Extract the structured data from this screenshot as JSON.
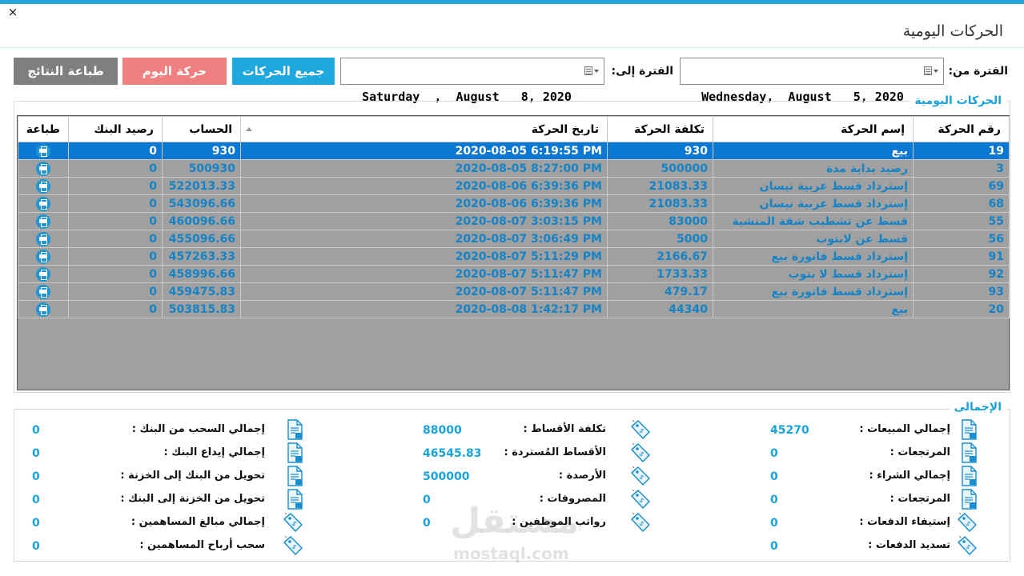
{
  "window": {
    "title": "الحركات اليومية",
    "close_glyph": "×"
  },
  "filters": {
    "from_label": "الفترة من:",
    "from_date": "Wednesday,  August   5, 2020",
    "to_label": "الفترة إلى:",
    "to_date": "Saturday  ,  August   8, 2020"
  },
  "buttons": {
    "all_movements": "جميع الحركات",
    "today_movements": "حركة اليوم",
    "print_results": "طباعة النتائج"
  },
  "colors": {
    "accent": "#1aa3d9",
    "selected_row": "#0a78d2",
    "today_button": "#f08080",
    "print_button": "#7f7f7f",
    "all_button": "#1ea8de"
  },
  "daily_group": {
    "title": "الحركات اليومية",
    "columns": [
      "رقم الحركة",
      "إسم الحركة",
      "تكلفة الحركة",
      "تاريخ الحركة",
      "الحساب",
      "رصيد البنك",
      "طباعة"
    ],
    "rows": [
      {
        "id": "19",
        "name": "بيع",
        "cost": "930",
        "date": "2020-08-05 6:19:55 PM",
        "account": "930",
        "bank": "0"
      },
      {
        "id": "3",
        "name": "رصيد بداية مدة",
        "cost": "500000",
        "date": "2020-08-05 8:27:00 PM",
        "account": "500930",
        "bank": "0"
      },
      {
        "id": "69",
        "name": "إسترداد قسط عربية نيسان",
        "cost": "21083.33",
        "date": "2020-08-06 6:39:36 PM",
        "account": "522013.33",
        "bank": "0"
      },
      {
        "id": "68",
        "name": "إسترداد قسط عربية نيسان",
        "cost": "21083.33",
        "date": "2020-08-06 6:39:36 PM",
        "account": "543096.66",
        "bank": "0"
      },
      {
        "id": "55",
        "name": "قسط عن تشطيب شقة المنشية",
        "cost": "83000",
        "date": "2020-08-07 3:03:15 PM",
        "account": "460096.66",
        "bank": "0"
      },
      {
        "id": "56",
        "name": "قسط عن لابتوب",
        "cost": "5000",
        "date": "2020-08-07 3:06:49 PM",
        "account": "455096.66",
        "bank": "0"
      },
      {
        "id": "91",
        "name": "إسترداد قسط فاتورة بيع",
        "cost": "2166.67",
        "date": "2020-08-07 5:11:29 PM",
        "account": "457263.33",
        "bank": "0"
      },
      {
        "id": "92",
        "name": "إسترداد قسط لا بتوب",
        "cost": "1733.33",
        "date": "2020-08-07 5:11:47 PM",
        "account": "458996.66",
        "bank": "0"
      },
      {
        "id": "93",
        "name": "إسترداد قسط فاتورة بيع",
        "cost": "479.17",
        "date": "2020-08-07 5:11:47 PM",
        "account": "459475.83",
        "bank": "0"
      },
      {
        "id": "20",
        "name": "بيع",
        "cost": "44340",
        "date": "2020-08-08 1:42:17 PM",
        "account": "503815.83",
        "bank": "0"
      }
    ]
  },
  "summary": {
    "title": "الإجمالى",
    "col1": [
      {
        "label": "إجمالي المبيعات :",
        "value": "45270",
        "icon": "document-icon"
      },
      {
        "label": "المرتجعات :",
        "value": "0",
        "icon": "document-icon"
      },
      {
        "label": "إجمالي الشراء :",
        "value": "0",
        "icon": "document-icon"
      },
      {
        "label": "المرتجعات :",
        "value": "0",
        "icon": "document-icon"
      },
      {
        "label": "إستيفاء الدفعات :",
        "value": "0",
        "icon": "money-tag-icon"
      },
      {
        "label": "تسديد الدفعات :",
        "value": "0",
        "icon": "money-tag-icon"
      }
    ],
    "col2": [
      {
        "label": "تكلفة الأقساط :",
        "value": "88000",
        "icon": "money-tag-icon"
      },
      {
        "label": "الأقساط المُستردة :",
        "value": "46545.83",
        "icon": "money-tag-icon"
      },
      {
        "label": "الأرصدة :",
        "value": "500000",
        "icon": "money-tag-icon"
      },
      {
        "label": "المصروفات :",
        "value": "0",
        "icon": "money-tag-icon"
      },
      {
        "label": "رواتب الموظفين :",
        "value": "0",
        "icon": "money-tag-icon"
      }
    ],
    "col3": [
      {
        "label": "إجمالي السحب من البنك :",
        "value": "0",
        "icon": "document-icon"
      },
      {
        "label": "إجمالي إيداع البنك :",
        "value": "0",
        "icon": "document-icon"
      },
      {
        "label": "تحويل من البنك إلى الخزنة :",
        "value": "0",
        "icon": "document-icon"
      },
      {
        "label": "تحويل من الخزنة إلى البنك :",
        "value": "0",
        "icon": "document-icon"
      },
      {
        "label": "إجمالي مبالغ المساهمين :",
        "value": "0",
        "icon": "money-tag-icon"
      },
      {
        "label": "سحب أرباح المساهمين :",
        "value": "0",
        "icon": "money-tag-icon"
      }
    ]
  },
  "watermark": {
    "text": "مستقل",
    "sub": "mostaql.com"
  }
}
